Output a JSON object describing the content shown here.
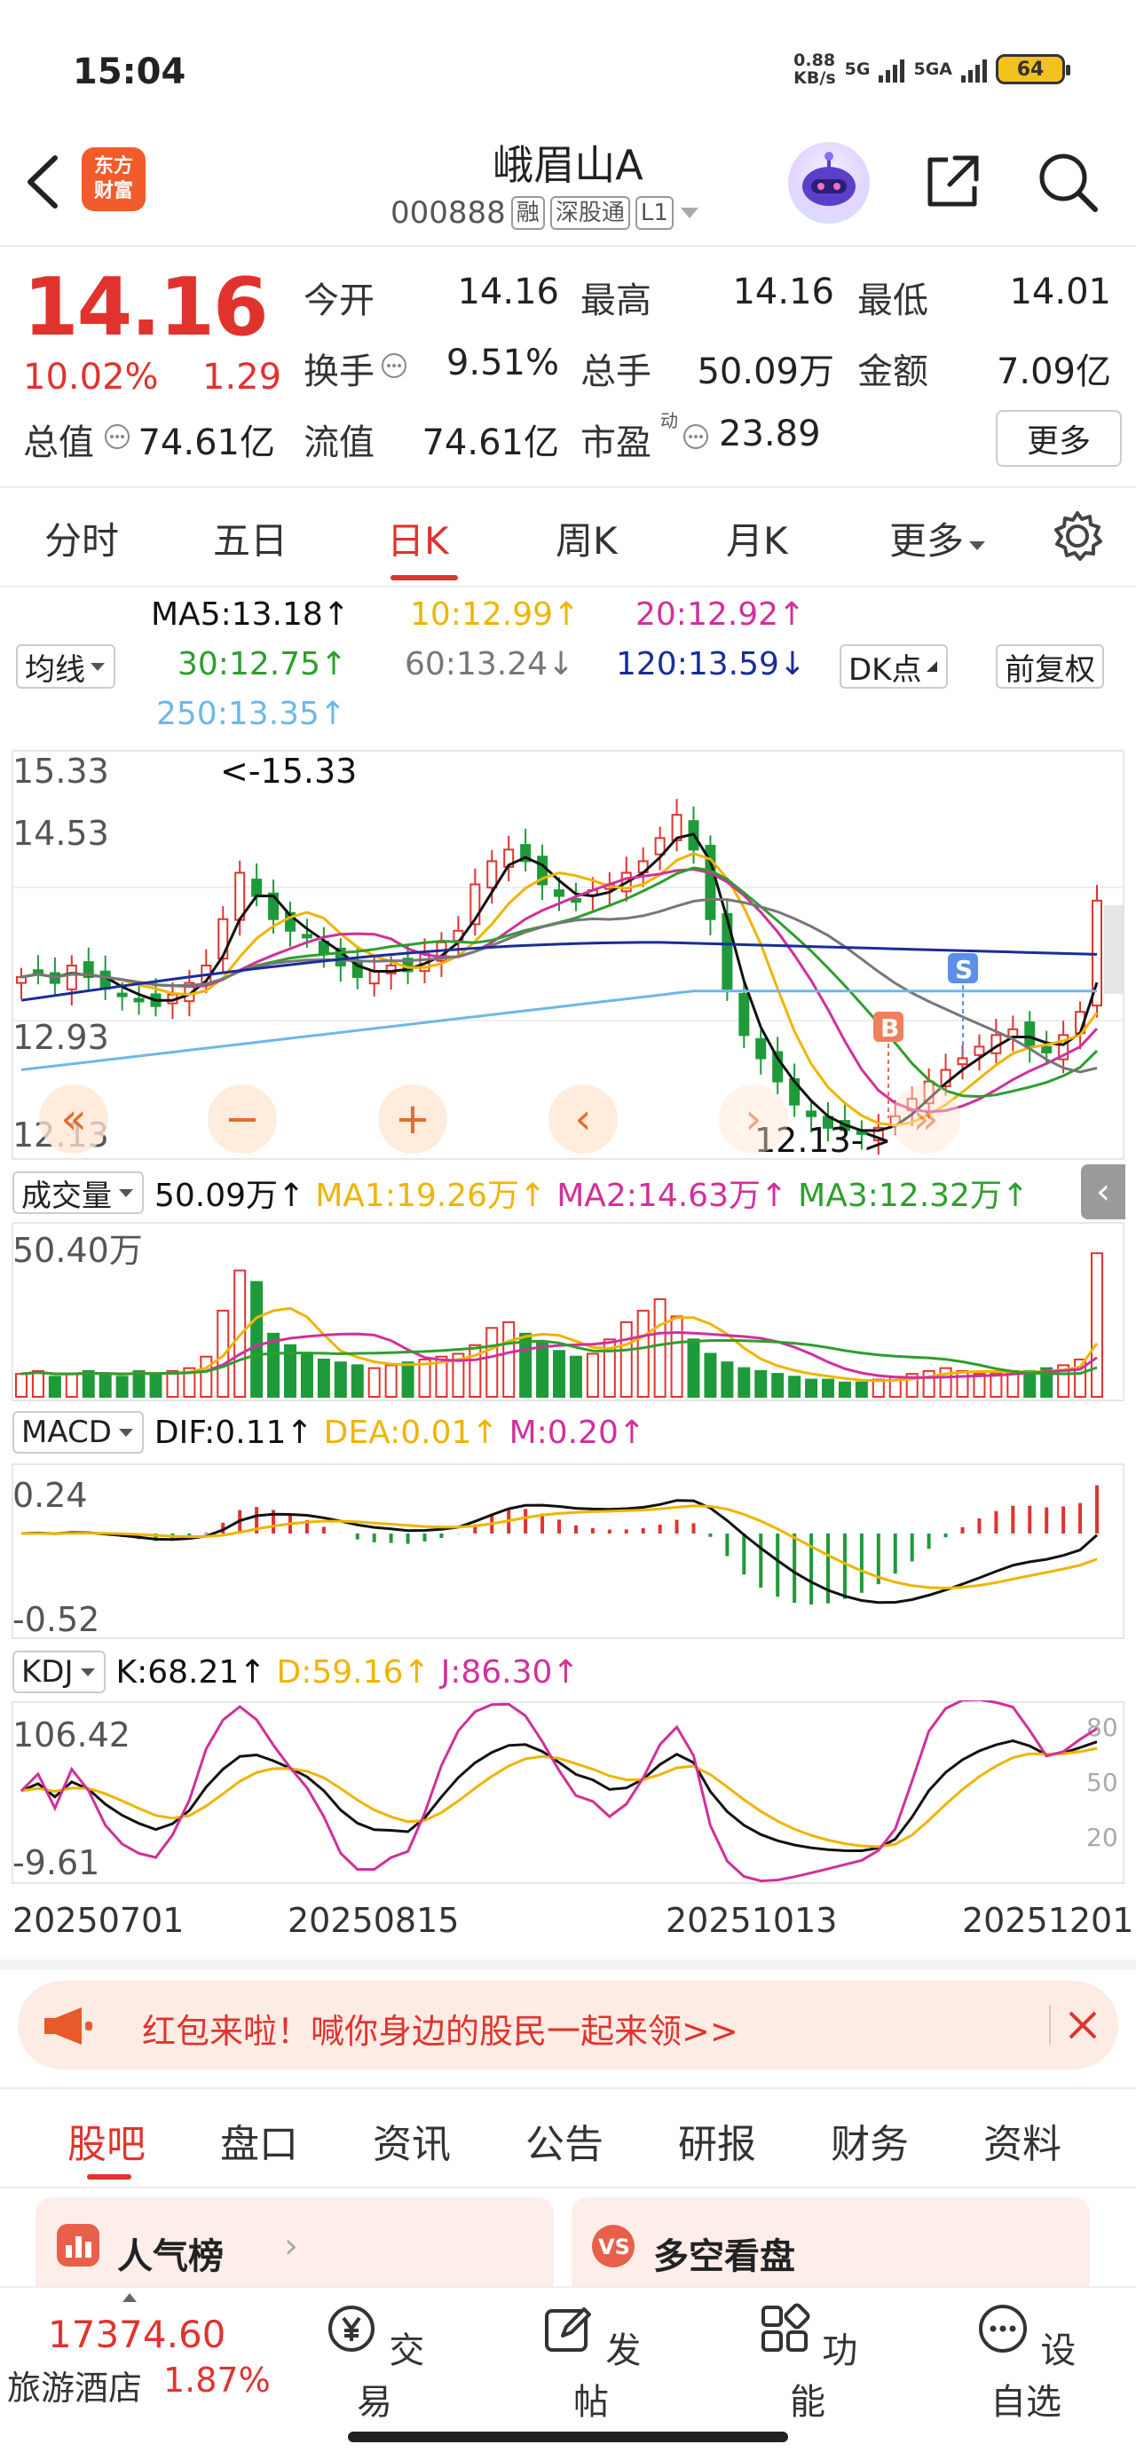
{
  "status_bar": {
    "time": "15:04",
    "net_speed_value": "0.88",
    "net_speed_unit": "KB/s",
    "signal1": "5G",
    "signal2": "5GA",
    "battery": "64"
  },
  "header": {
    "logo_line1": "东方",
    "logo_line2": "财富",
    "stock_name": "峨眉山A",
    "stock_code": "000888",
    "tags": [
      "融",
      "深股通",
      "L1"
    ]
  },
  "quote": {
    "price": "14.16",
    "pct_change": "10.02%",
    "change": "1.29",
    "fields": [
      {
        "label": "今开",
        "value": "14.16",
        "color": "red"
      },
      {
        "label": "最高",
        "value": "14.16",
        "color": "red"
      },
      {
        "label": "最低",
        "value": "14.01",
        "color": "red"
      },
      {
        "label": "换手",
        "value": "9.51%",
        "color": "dark"
      },
      {
        "label": "总手",
        "value": "50.09万",
        "color": "dark"
      },
      {
        "label": "金额",
        "value": "7.09亿",
        "color": "dark"
      },
      {
        "label": "总值",
        "value": "74.61亿",
        "color": "dark"
      },
      {
        "label": "流值",
        "value": "74.61亿",
        "color": "dark"
      },
      {
        "label": "市盈",
        "value": "23.89",
        "color": "dark"
      }
    ],
    "pe_superscript": "动",
    "more_label": "更多"
  },
  "period_tabs": [
    "分时",
    "五日",
    "日K",
    "周K",
    "月K",
    "更多"
  ],
  "active_period": "日K",
  "ma_values": {
    "selector": "均线",
    "ma5": "MA5:13.18",
    "ma10": "10:12.99",
    "ma20": "20:12.92",
    "ma30": "30:12.75",
    "ma60": "60:13.24",
    "ma120": "120:13.59",
    "ma250": "250:13.35",
    "dk_label": "DK点",
    "adjust_label": "前复权"
  },
  "colors": {
    "red": "#e0332e",
    "green": "#1f9a3a",
    "ma5": "#111111",
    "ma10": "#f0b400",
    "ma20": "#d0309c",
    "ma30": "#2e9e2e",
    "ma60": "#777777",
    "ma120": "#1a2c9a",
    "ma250": "#6db8e8"
  },
  "chart_data": [
    {
      "type": "candlestick",
      "title": "",
      "y_ticks": [
        "15.33",
        "14.53",
        "12.93",
        "12.13"
      ],
      "ylim": [
        12.13,
        15.33
      ],
      "annotations": [
        "<-15.33",
        "12.13->"
      ],
      "markers": [
        "B",
        "S"
      ],
      "x_ticks": [
        "20250701",
        "20250815",
        "20251013",
        "20251201"
      ],
      "close_series": [
        13.5,
        13.55,
        13.45,
        13.6,
        13.5,
        13.4,
        13.35,
        13.3,
        13.25,
        13.35,
        13.45,
        13.6,
        14.0,
        14.4,
        14.2,
        14.0,
        13.9,
        13.85,
        13.7,
        13.6,
        13.5,
        13.55,
        13.6,
        13.55,
        13.7,
        13.8,
        13.9,
        14.3,
        14.5,
        14.6,
        14.5,
        14.3,
        14.2,
        14.15,
        14.25,
        14.3,
        14.4,
        14.5,
        14.7,
        14.9,
        14.6,
        14.0,
        13.4,
        13.0,
        12.8,
        12.6,
        12.4,
        12.3,
        12.2,
        12.18,
        12.15,
        12.2,
        12.3,
        12.45,
        12.6,
        12.7,
        12.8,
        12.9,
        13.0,
        13.05,
        12.9,
        12.85,
        13.0,
        13.2,
        14.16
      ]
    },
    {
      "type": "bar",
      "title": "成交量",
      "legend": [
        "50.09万",
        "MA1:19.26万",
        "MA2:14.63万",
        "MA3:12.32万"
      ],
      "y_ticks": [
        "50.40万"
      ],
      "values": [
        8,
        9,
        7,
        8,
        9,
        8,
        7,
        9,
        8,
        9,
        10,
        14,
        30,
        44,
        40,
        22,
        18,
        15,
        13,
        12,
        11,
        10,
        11,
        12,
        13,
        14,
        15,
        18,
        24,
        26,
        22,
        19,
        16,
        14,
        15,
        20,
        26,
        30,
        34,
        28,
        20,
        15,
        12,
        10,
        9,
        8,
        7,
        6,
        6,
        5,
        5,
        6,
        7,
        8,
        9,
        10,
        9,
        8,
        8,
        9,
        9,
        10,
        11,
        13,
        50
      ]
    },
    {
      "type": "bar",
      "title": "MACD",
      "legend": [
        "DIF:0.11",
        "DEA:0.01",
        "M:0.20"
      ],
      "y_ticks": [
        "0.24",
        "-0.52"
      ]
    },
    {
      "type": "line",
      "title": "KDJ",
      "legend": [
        "K:68.21",
        "D:59.16",
        "J:86.30"
      ],
      "y_ticks": [
        "106.42",
        "-9.61"
      ],
      "right_ticks": [
        "80",
        "50",
        "20"
      ]
    }
  ],
  "volume_selector": "成交量",
  "macd_selector": "MACD",
  "kdj_selector": "KDJ",
  "banner": {
    "text": "红包来啦！喊你身边的股民一起来领>>"
  },
  "bottom_tabs": [
    "股吧",
    "盘口",
    "资讯",
    "公告",
    "研报",
    "财务",
    "资料"
  ],
  "cards": {
    "left": "人气榜",
    "right": "多空看盘"
  },
  "bottom_nav": {
    "index_value": "17374.60",
    "index_name": "旅游酒店",
    "index_pct": "1.87%",
    "items": [
      "交易",
      "发帖",
      "功能",
      "设自选"
    ]
  }
}
